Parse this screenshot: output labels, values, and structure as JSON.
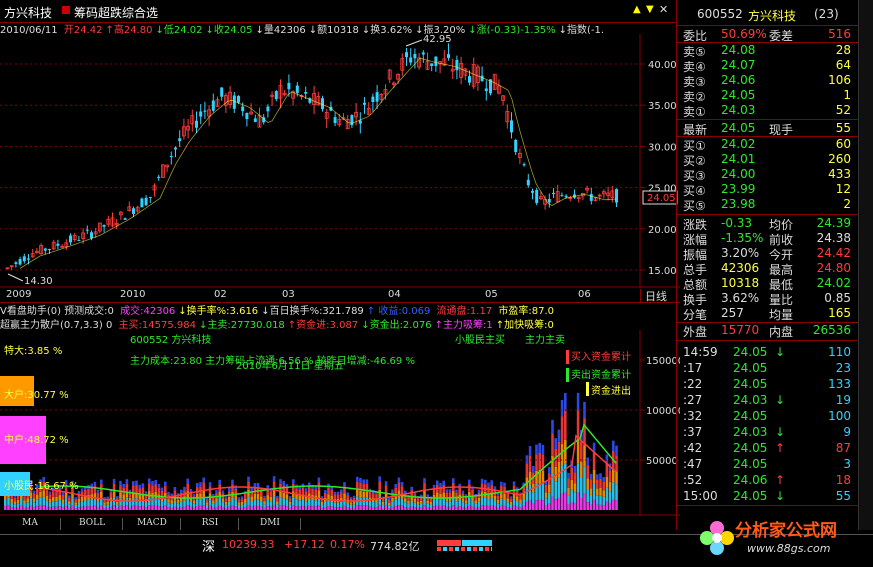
{
  "title": {
    "stock_name": "方兴科技",
    "formula_name": "筹码超跌综合选",
    "buttons": [
      "▲",
      "▼",
      "✕"
    ]
  },
  "info_line": [
    {
      "t": "2010/06/11 ",
      "c": "#dddddd"
    },
    {
      "t": "开24.42",
      "c": "#ff3c3c"
    },
    {
      "t": "↑高24.80",
      "c": "#ff3c3c"
    },
    {
      "t": "↓低24.02",
      "c": "#2ee82e"
    },
    {
      "t": "↓收24.05",
      "c": "#2ee82e"
    },
    {
      "t": "↓量42306",
      "c": "#dddddd"
    },
    {
      "t": "↓额10318",
      "c": "#dddddd"
    },
    {
      "t": "↓换3.62%",
      "c": "#dddddd"
    },
    {
      "t": "↓振3.20%",
      "c": "#dddddd"
    },
    {
      "t": "↓涨(-0.33)-1.35%",
      "c": "#2ee82e"
    },
    {
      "t": "↓指数(-1.",
      "c": "#dddddd"
    }
  ],
  "main_chart": {
    "price_ticks": [
      "40.00",
      "35.00",
      "30.00",
      "25.00",
      "20.00",
      "15.00"
    ],
    "high_label": "42.95",
    "low_label": "14.30",
    "last_price": "24.05",
    "x_labels": [
      "2009",
      "2010",
      "02",
      "03",
      "04",
      "05",
      "06"
    ],
    "x_unit": "日线"
  },
  "indicator_lines": {
    "line1": [
      {
        "t": "V看盘助手(0) 预测成交:0 ",
        "c": "#dddddd"
      },
      {
        "t": "成交:42306",
        "c": "#ff40ff"
      },
      {
        "t": "↓换手率%:3.616",
        "c": "#ffff40"
      },
      {
        "t": "↓百日换手%:321.789",
        "c": "#dddddd"
      },
      {
        "t": "↑ 收益:0.069 ",
        "c": "#3060ff"
      },
      {
        "t": "流通盘:1.17",
        "c": "#ff3c3c"
      },
      {
        "t": " 市盈率:87.0",
        "c": "#ffff40"
      }
    ],
    "line2": [
      {
        "t": "超赢主力散户(0.7,3.3) 0 ",
        "c": "#dddddd"
      },
      {
        "t": "主买:14575.984",
        "c": "#ff3c3c"
      },
      {
        "t": "↓主卖:27730.018",
        "c": "#2ee82e"
      },
      {
        "t": "↑资金进:3.087",
        "c": "#ff3c3c"
      },
      {
        "t": "↓资金出:2.076",
        "c": "#2ee82e"
      },
      {
        "t": "↑主力吸筹:1",
        "c": "#ff40ff"
      },
      {
        "t": "↑加快吸筹:0",
        "c": "#ffff40"
      }
    ]
  },
  "sub_chart": {
    "line_a": "600552 方兴科技",
    "line_b": "2010年6月11日 星期五",
    "line_c": "小股民主买",
    "line_d": "主力主卖",
    "line_e": "主力成本:23.80 主力筹码占流通:6.56 % 较昨日增减:-46.69 %",
    "te_da": "特大:3.85 %",
    "da_hu": "大户:30.77 %",
    "zhong_hu": "中户:48.72 %",
    "xiao_min": "小股民:16.67 %",
    "legend": [
      "买入资金累计",
      "卖出资金累计",
      "资金进出"
    ],
    "vol_ticks": [
      "150000",
      "100000",
      "50000"
    ]
  },
  "tabs": [
    "MA",
    "BOLL",
    "MACD",
    "RSI",
    "DMI"
  ],
  "status_bar": {
    "index_name": "深",
    "index_value": "10239.33",
    "change": "+17.12",
    "pct": "0.17%",
    "amount": "774.82亿"
  },
  "watermark": {
    "brand": "分析家公式网",
    "url": "www.88gs.com"
  },
  "right_panel": {
    "code": "600552",
    "name": "方兴科技",
    "count": "(23)",
    "weibi": {
      "label": "委比",
      "value": "50.69%",
      "diff_label": "委差",
      "diff": "516"
    },
    "sells": [
      {
        "label": "卖⑤",
        "price": "24.08",
        "vol": "28"
      },
      {
        "label": "卖④",
        "price": "24.07",
        "vol": "64"
      },
      {
        "label": "卖③",
        "price": "24.06",
        "vol": "106"
      },
      {
        "label": "卖②",
        "price": "24.05",
        "vol": "1"
      },
      {
        "label": "卖①",
        "price": "24.03",
        "vol": "52"
      }
    ],
    "latest": {
      "label": "最新",
      "price": "24.05",
      "hand_label": "现手",
      "hand": "55"
    },
    "buys": [
      {
        "label": "买①",
        "price": "24.02",
        "vol": "60"
      },
      {
        "label": "买②",
        "price": "24.01",
        "vol": "260"
      },
      {
        "label": "买③",
        "price": "24.00",
        "vol": "433"
      },
      {
        "label": "买④",
        "price": "23.99",
        "vol": "12"
      },
      {
        "label": "买⑤",
        "price": "23.98",
        "vol": "2"
      }
    ],
    "stats": [
      {
        "l1": "涨跌",
        "v1": "-0.33",
        "l2": "均价",
        "v2": "24.39"
      },
      {
        "l1": "涨幅",
        "v1": "-1.35%",
        "l2": "前收",
        "v2": "24.38"
      },
      {
        "l1": "振幅",
        "v1": "3.20%",
        "l2": "今开",
        "v2": "24.42"
      },
      {
        "l1": "总手",
        "v1": "42306",
        "l2": "最高",
        "v2": "24.80"
      },
      {
        "l1": "总额",
        "v1": "10318",
        "l2": "最低",
        "v2": "24.02"
      },
      {
        "l1": "换手",
        "v1": "3.62%",
        "l2": "量比",
        "v2": "0.85"
      },
      {
        "l1": "分笔",
        "v1": "257",
        "l2": "均量",
        "v2": "165"
      }
    ],
    "outer": {
      "l1": "外盘",
      "v1": "15770",
      "l2": "内盘",
      "v2": "26536"
    },
    "ticks": [
      {
        "time": "14:59",
        "price": "24.05",
        "dir": "↓",
        "vol": "110"
      },
      {
        "time": ":17",
        "price": "24.05",
        "dir": "",
        "vol": "23"
      },
      {
        "time": ":22",
        "price": "24.05",
        "dir": "",
        "vol": "133"
      },
      {
        "time": ":27",
        "price": "24.03",
        "dir": "↓",
        "vol": "19"
      },
      {
        "time": ":32",
        "price": "24.05",
        "dir": "",
        "vol": "100"
      },
      {
        "time": ":37",
        "price": "24.03",
        "dir": "↓",
        "vol": "9"
      },
      {
        "time": ":42",
        "price": "24.05",
        "dir": "↑",
        "vol": "87"
      },
      {
        "time": ":47",
        "price": "24.05",
        "dir": "",
        "vol": "3"
      },
      {
        "time": ":52",
        "price": "24.06",
        "dir": "↑",
        "vol": "18"
      },
      {
        "time": "15:00",
        "price": "24.05",
        "dir": "↓",
        "vol": "55"
      }
    ]
  },
  "colors": {
    "up": "#ff3c3c",
    "down": "#2ee82e",
    "cyan": "#31d2ff",
    "border": "#800000"
  }
}
